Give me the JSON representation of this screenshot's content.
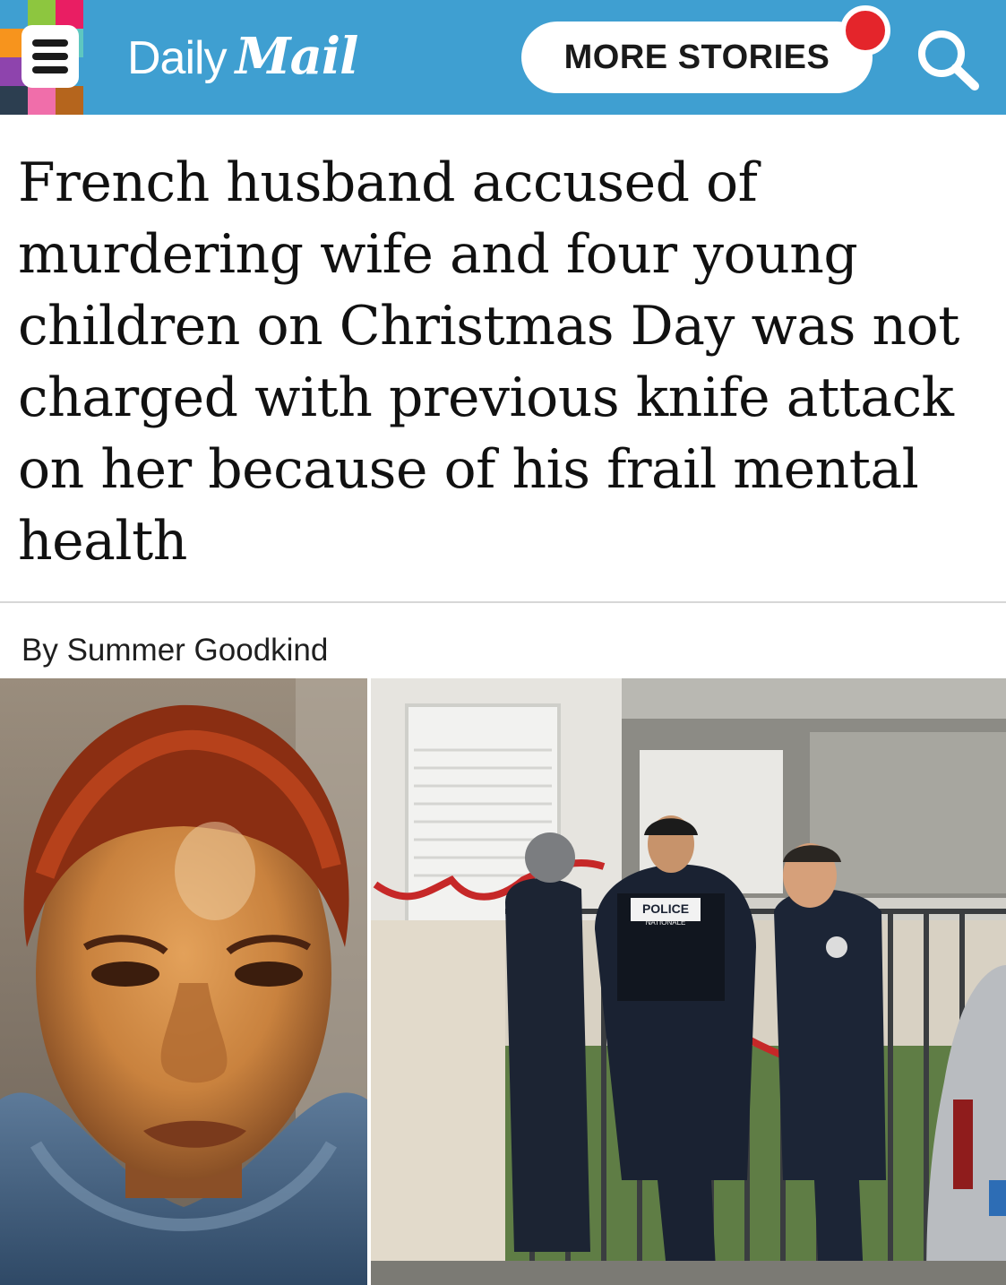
{
  "header": {
    "brand_part1": "Daily",
    "brand_part2": "Mail",
    "more_stories_label": "MORE STORIES",
    "accent_color": "#3f9fd1",
    "notify_color": "#e4252b",
    "icons": [
      "menu-icon",
      "search-icon"
    ],
    "mosaic_colors": [
      "#3f9fd1",
      "#8dc63f",
      "#e91e63",
      "#3f9fd1",
      "#f7941d",
      "#ffffff",
      "#5ec7c0",
      "#3f9fd1",
      "#8e44ad",
      "#e4252b",
      "#3f9fd1",
      "#3f9fd1",
      "#2c3e50",
      "#f06eaa",
      "#b5651d",
      "#3f9fd1"
    ]
  },
  "article": {
    "headline": "French husband accused of murdering wife and four young children on Christmas Day was not charged with previous knife attack on her because of his frail mental health",
    "byline": "By Summer Goodkind"
  },
  "photos": {
    "right_vest_label": "POLICE",
    "right_vest_sublabel": "NATIONALE"
  }
}
